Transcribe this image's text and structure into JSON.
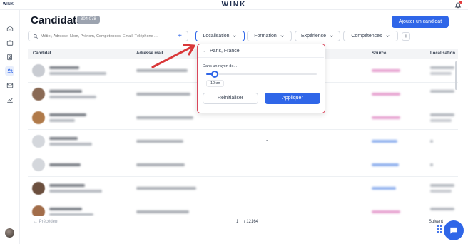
{
  "app": {
    "logo_text": "WINK",
    "brand": "WINK"
  },
  "sidebar": {
    "items": [
      {
        "name": "home-icon",
        "active": false
      },
      {
        "name": "briefcase-icon",
        "active": false
      },
      {
        "name": "contacts-icon",
        "active": false
      },
      {
        "name": "people-icon",
        "active": true
      },
      {
        "name": "mail-icon",
        "active": false
      },
      {
        "name": "chart-icon",
        "active": false
      }
    ]
  },
  "header": {
    "title": "Candidats",
    "count": "304 078",
    "add_button": "Ajouter un candidat"
  },
  "search": {
    "placeholder": "Métier, Adresse, Nom, Prénom, Compétences, Email, Téléphone ...",
    "value": ""
  },
  "filters": {
    "localisation": "Localisation",
    "formation": "Formation",
    "experience": "Expérience",
    "competences": "Compétences",
    "more": "+"
  },
  "table": {
    "columns": {
      "candidat": "Candidat",
      "email": "Adresse mail",
      "source": "Source",
      "localisation": "Localisation"
    },
    "dash": "-"
  },
  "popup": {
    "location": "Paris, France",
    "radius_label": "Dans un rayon de...",
    "radius_value": "10km",
    "radius_fraction": 0.08,
    "reset": "Réinitialiser",
    "apply": "Appliquer"
  },
  "pagination": {
    "prev": "Précédent",
    "current": "1",
    "total": "/ 12164",
    "next": "Suivant"
  },
  "colors": {
    "accent": "#2f66e8",
    "highlight": "#d9475b"
  }
}
